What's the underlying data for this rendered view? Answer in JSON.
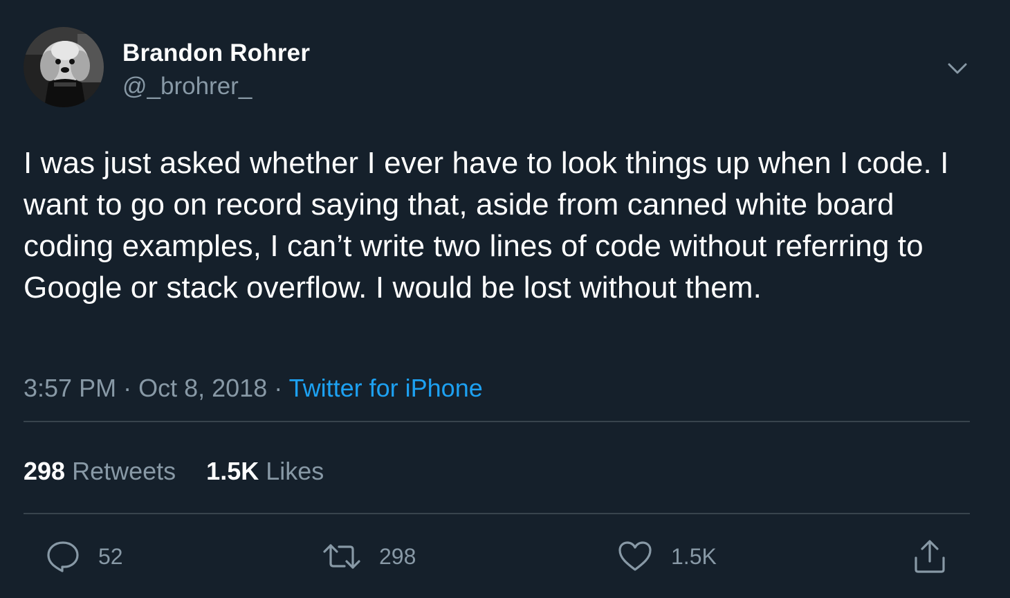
{
  "author": {
    "name": "Brandon Rohrer",
    "handle": "@_brohrer_",
    "avatar_icon": "dog-avatar"
  },
  "tweet": {
    "text": "I was just asked whether I ever have to look things up when I code. I want to go on record saying that, aside from canned white board coding examples, I can’t write two lines of code without referring to Google or stack overflow. I would be lost without them.",
    "time": "3:57 PM",
    "date": "Oct 8, 2018",
    "separator": "·",
    "source": "Twitter for iPhone"
  },
  "stats": {
    "retweets_count": "298",
    "retweets_label": "Retweets",
    "likes_count": "1.5K",
    "likes_label": "Likes"
  },
  "actions": {
    "reply_count": "52",
    "retweet_count": "298",
    "like_count": "1.5K"
  },
  "colors": {
    "background": "#15202b",
    "text": "#ffffff",
    "secondary": "#8899a6",
    "link": "#1da1f2",
    "divider": "#38444d"
  },
  "icons": [
    "dog-avatar",
    "chevron-down-icon",
    "reply-icon",
    "retweet-icon",
    "heart-icon",
    "share-icon"
  ]
}
